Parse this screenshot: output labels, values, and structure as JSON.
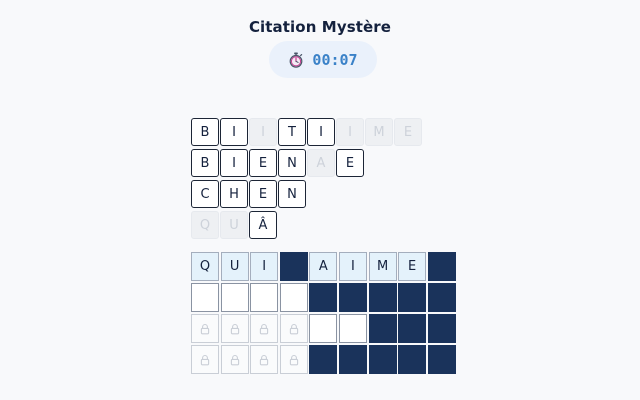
{
  "header": {
    "title": "Citation Mystère",
    "timer": "00:07"
  },
  "source_rows": [
    [
      {
        "l": "B",
        "s": "on"
      },
      {
        "l": "I",
        "s": "on"
      },
      {
        "l": "I",
        "s": "off"
      },
      {
        "l": "T",
        "s": "on"
      },
      {
        "l": "I",
        "s": "on"
      },
      {
        "l": "I",
        "s": "off"
      },
      {
        "l": "M",
        "s": "off"
      },
      {
        "l": "E",
        "s": "off"
      }
    ],
    [
      {
        "l": "B",
        "s": "on"
      },
      {
        "l": "I",
        "s": "on"
      },
      {
        "l": "E",
        "s": "on"
      },
      {
        "l": "N",
        "s": "on"
      },
      {
        "l": "A",
        "s": "off"
      },
      {
        "l": "E",
        "s": "on"
      }
    ],
    [
      {
        "l": "C",
        "s": "on"
      },
      {
        "l": "H",
        "s": "on"
      },
      {
        "l": "E",
        "s": "on"
      },
      {
        "l": "N",
        "s": "on"
      }
    ],
    [
      {
        "l": "Q",
        "s": "off"
      },
      {
        "l": "U",
        "s": "off"
      },
      {
        "l": "Â",
        "s": "on"
      }
    ]
  ],
  "grid": [
    [
      {
        "t": "lf",
        "l": "Q"
      },
      {
        "t": "lf",
        "l": "U"
      },
      {
        "t": "lf",
        "l": "I"
      },
      {
        "t": "bl"
      },
      {
        "t": "lf",
        "l": "A"
      },
      {
        "t": "lf",
        "l": "I"
      },
      {
        "t": "lf",
        "l": "M"
      },
      {
        "t": "lf",
        "l": "E"
      },
      {
        "t": "bl"
      }
    ],
    [
      {
        "t": "em"
      },
      {
        "t": "em"
      },
      {
        "t": "em"
      },
      {
        "t": "em"
      },
      {
        "t": "bl"
      },
      {
        "t": "bl"
      },
      {
        "t": "bl"
      },
      {
        "t": "bl"
      },
      {
        "t": "bl"
      }
    ],
    [
      {
        "t": "lk"
      },
      {
        "t": "lk"
      },
      {
        "t": "lk"
      },
      {
        "t": "lk"
      },
      {
        "t": "em"
      },
      {
        "t": "em"
      },
      {
        "t": "bl"
      },
      {
        "t": "bl"
      },
      {
        "t": "bl"
      }
    ],
    [
      {
        "t": "lk"
      },
      {
        "t": "lk"
      },
      {
        "t": "lk"
      },
      {
        "t": "lk"
      },
      {
        "t": "bl"
      },
      {
        "t": "bl"
      },
      {
        "t": "bl"
      },
      {
        "t": "bl"
      },
      {
        "t": "bl"
      }
    ]
  ]
}
